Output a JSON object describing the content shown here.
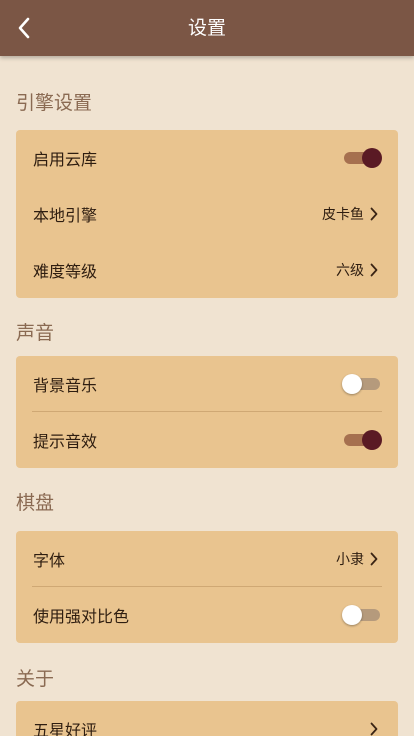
{
  "header": {
    "title": "设置"
  },
  "sections": {
    "engine": {
      "title": "引擎设置",
      "cloud_label": "启用云库",
      "cloud_on": true,
      "local_engine_label": "本地引擎",
      "local_engine_value": "皮卡鱼",
      "difficulty_label": "难度等级",
      "difficulty_value": "六级"
    },
    "sound": {
      "title": "声音",
      "bgm_label": "背景音乐",
      "bgm_on": false,
      "hint_label": "提示音效",
      "hint_on": true
    },
    "board": {
      "title": "棋盘",
      "font_label": "字体",
      "font_value": "小隶",
      "contrast_label": "使用强对比色",
      "contrast_on": false
    },
    "about": {
      "title": "关于",
      "rate_label": "五星好评"
    }
  },
  "colors": {
    "navbar": "#7b5645",
    "background": "#f0e3d1",
    "card": "#e9c48f",
    "toggle_on_knob": "#5a1a24",
    "toggle_on_track": "#a6704f"
  }
}
